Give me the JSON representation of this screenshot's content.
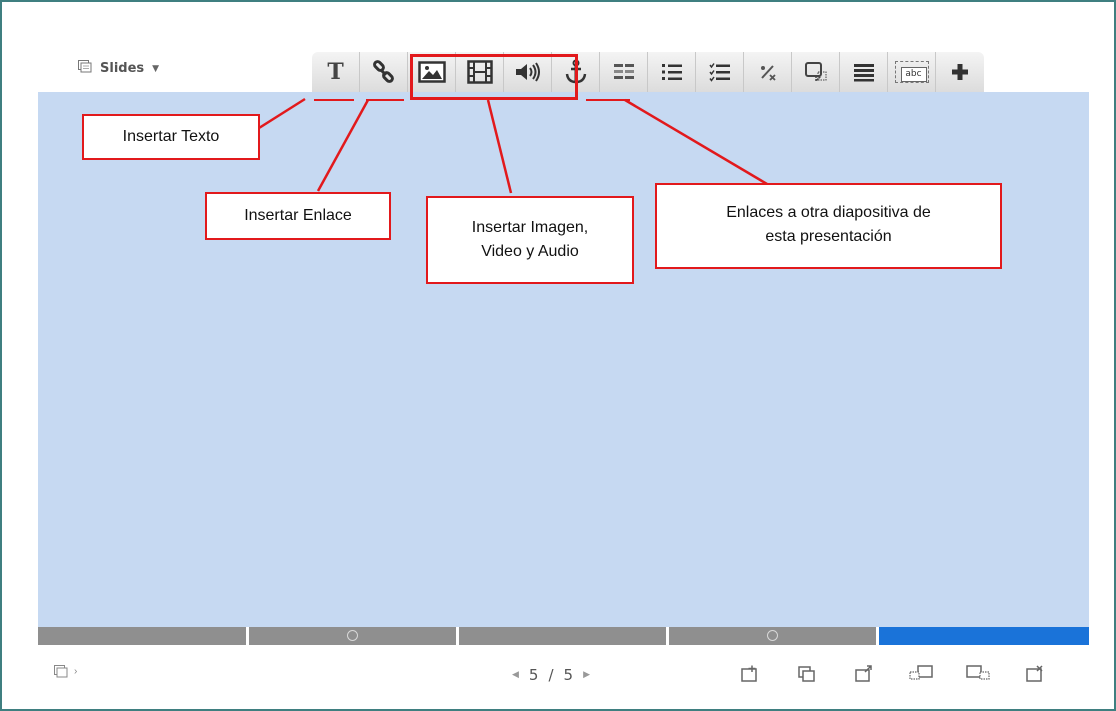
{
  "top_menu": {
    "label": "Slides"
  },
  "toolbar": {
    "buttons": [
      {
        "id": "text",
        "icon": "text-icon"
      },
      {
        "id": "link",
        "icon": "link-icon"
      },
      {
        "id": "image",
        "icon": "image-icon"
      },
      {
        "id": "video",
        "icon": "film-icon"
      },
      {
        "id": "audio",
        "icon": "speaker-icon"
      },
      {
        "id": "anchor",
        "icon": "anchor-icon"
      },
      {
        "id": "table",
        "icon": "table-icon"
      },
      {
        "id": "numbered-list",
        "icon": "numbered-list-icon"
      },
      {
        "id": "checklist",
        "icon": "checklist-icon"
      },
      {
        "id": "formula",
        "icon": "formula-icon"
      },
      {
        "id": "speech-bubble",
        "icon": "speech-bubble-icon"
      },
      {
        "id": "list",
        "icon": "list-icon"
      },
      {
        "id": "text-field",
        "icon": "text-field-icon"
      },
      {
        "id": "add",
        "icon": "plus-icon"
      }
    ],
    "text_field_label": "abc",
    "text_glyph": "T"
  },
  "callouts": {
    "insert_text": "Insertar Texto",
    "insert_link": "Insertar Enlace",
    "insert_media_line1": "Insertar Imagen,",
    "insert_media_line2": "Video y Audio",
    "slide_links_line1": "Enlaces a otra diapositiva de",
    "slide_links_line2": "esta presentación"
  },
  "timeline": {
    "segments": 5,
    "active_segment": 5
  },
  "pager": {
    "current": "5",
    "separator": "/",
    "total": "5"
  },
  "bottom_tools": [
    "add-slide-icon",
    "duplicate-slide-icon",
    "import-slide-icon",
    "move-slide-left-icon",
    "move-slide-right-icon",
    "delete-slide-icon"
  ],
  "colors": {
    "canvas": "#c6d9f2",
    "active_segment": "#1a73d9",
    "annotation": "#e2191c",
    "frame": "#3f7f80"
  }
}
